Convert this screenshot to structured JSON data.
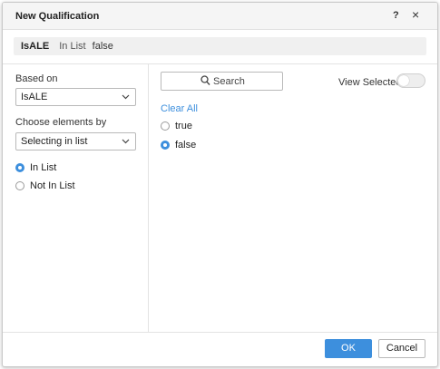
{
  "dialog": {
    "title": "New Qualification",
    "help_label": "?",
    "close_label": "×"
  },
  "summary": {
    "attribute": "IsALE",
    "operator": "In List",
    "value": "false"
  },
  "left": {
    "based_on_label": "Based on",
    "based_on_value": "IsALE",
    "choose_label": "Choose elements by",
    "choose_value": "Selecting in list",
    "radios": [
      {
        "label": "In List",
        "selected": true
      },
      {
        "label": "Not In List",
        "selected": false
      }
    ]
  },
  "right": {
    "search_label": "Search",
    "view_selected_label": "View Selected",
    "view_selected_on": false,
    "clear_all_label": "Clear All",
    "options": [
      {
        "label": "true",
        "selected": false
      },
      {
        "label": "false",
        "selected": true
      }
    ]
  },
  "footer": {
    "ok_label": "OK",
    "cancel_label": "Cancel"
  },
  "colors": {
    "accent": "#3d8fdd"
  }
}
